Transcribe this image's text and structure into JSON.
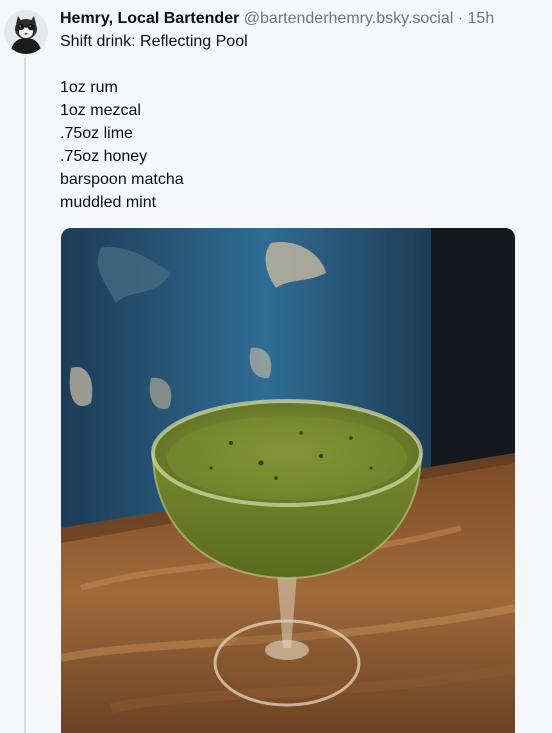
{
  "post": {
    "author_name": "Hemry, Local Bartender",
    "handle": "@bartenderhemry.bsky.social",
    "separator": "·",
    "timestamp": "15h",
    "title_line": "Shift drink: Reflecting Pool",
    "recipe": [
      "1oz rum",
      "1oz mezcal",
      ".75oz lime",
      ".75oz honey",
      "barspoon matcha",
      "muddled mint"
    ]
  },
  "icons": {
    "avatar": "avatar-cat-icon"
  },
  "colors": {
    "handle": "#6b7785",
    "thread_line": "#d4dbe2",
    "background": "#f5f7fa"
  }
}
